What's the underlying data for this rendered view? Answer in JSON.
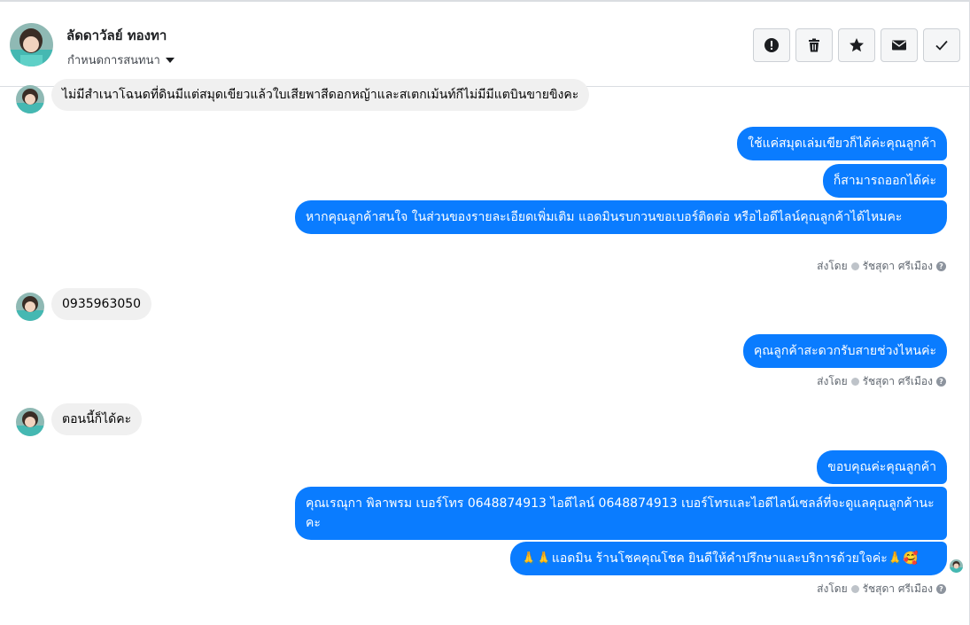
{
  "header": {
    "contact_name": "ลัดดาวัลย์ ทองทา",
    "assign_label": "กำหนดการสนทนา",
    "actions": [
      {
        "icon": "alert-icon",
        "label": "Mark as spam"
      },
      {
        "icon": "trash-icon",
        "label": "Delete"
      },
      {
        "icon": "star-icon",
        "label": "Star"
      },
      {
        "icon": "envelope-icon",
        "label": "Mark unread"
      },
      {
        "icon": "check-icon",
        "label": "Mark done"
      }
    ]
  },
  "messages": {
    "in1": "ไม่มีสำเนาโฉนดที่ดินมีแต่สมุดเขียวแล้วใบเสียพาสีดอกหญ้าและสเตกเม้นท์กีไม่มีมีแตบินขายขิงคะ",
    "out1": "ใช้แค่สมุดเล่มเขียวก็ได้ค่ะคุณลูกค้า",
    "out2": "ก็สามารถออกได้ค่ะ",
    "out3": "หากคุณลูกค้าสนใจ ในส่วนของรายละเอียดเพิ่มเติม แอดมินรบกวนขอเบอร์ติดต่อ หรือไอดีไลน์คุณลูกค้าได้ไหมคะ",
    "in2": "0935963050",
    "out4": "คุณลูกค้าสะดวกรับสายช่วงไหนค่ะ",
    "in3": "ตอนนี้ก็ได้คะ",
    "out5": "ขอบคุณค่ะคุณลูกค้า",
    "out6": "คุณเรณุกา พิลาพรม        เบอร์โทร 0648874913  ไอดีไลน์ 0648874913   เบอร์โทรและไอดีไลน์เซลล์ที่จะดูแลคุณลูกค้านะคะ",
    "out7": "🙏🙏แอดมิน ร้านโชคคุณโชค ยินดีให้คำปรึกษาและบริการด้วยใจค่ะ🙏🥰"
  },
  "sent_by": {
    "prefix": "ส่งโดย",
    "agent": "รัชสุดา ศรีเมือง"
  },
  "colors": {
    "outgoing": "#0a7cff",
    "incoming": "#f0f0f0"
  }
}
